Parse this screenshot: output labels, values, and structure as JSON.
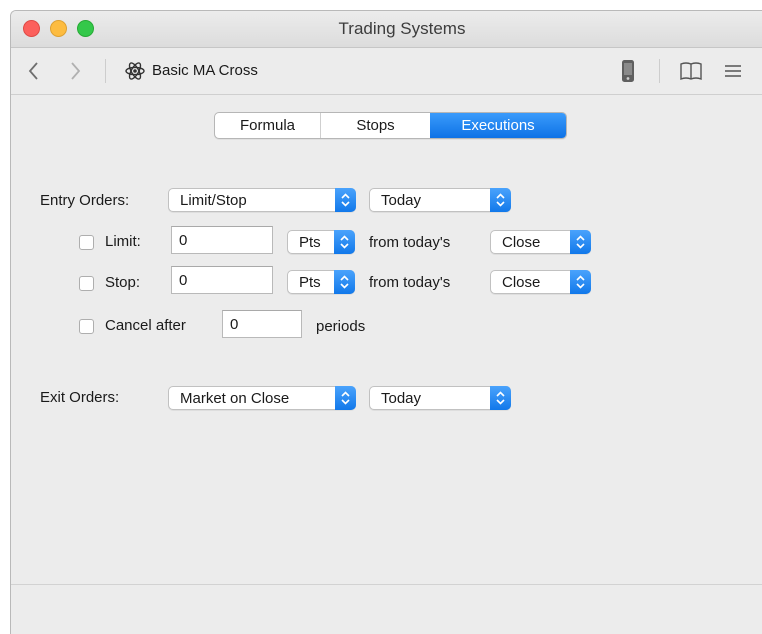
{
  "window": {
    "title": "Trading Systems"
  },
  "toolbar": {
    "system_name": "Basic MA Cross",
    "icons": [
      "back-chevron-icon",
      "forward-chevron-icon",
      "atom-icon",
      "phone-icon",
      "book-icon",
      "list-icon"
    ]
  },
  "tabs": [
    {
      "label": "Formula",
      "selected": false
    },
    {
      "label": "Stops",
      "selected": false
    },
    {
      "label": "Executions",
      "selected": true
    }
  ],
  "entry": {
    "label": "Entry Orders:",
    "order_type": "Limit/Stop",
    "timing": "Today",
    "limit": {
      "checked": false,
      "label": "Limit:",
      "value": "0",
      "unit": "Pts",
      "from_label": "from today's",
      "reference": "Close"
    },
    "stop": {
      "checked": false,
      "label": "Stop:",
      "value": "0",
      "unit": "Pts",
      "from_label": "from today's",
      "reference": "Close"
    },
    "cancel": {
      "checked": false,
      "label": "Cancel after",
      "value": "0",
      "suffix": "periods"
    }
  },
  "exit": {
    "label": "Exit Orders:",
    "order_type": "Market on Close",
    "timing": "Today"
  },
  "colors": {
    "accent": "#1178ea",
    "close": "#fc605c",
    "minimize": "#fdbc40",
    "maximize": "#34c84a"
  }
}
